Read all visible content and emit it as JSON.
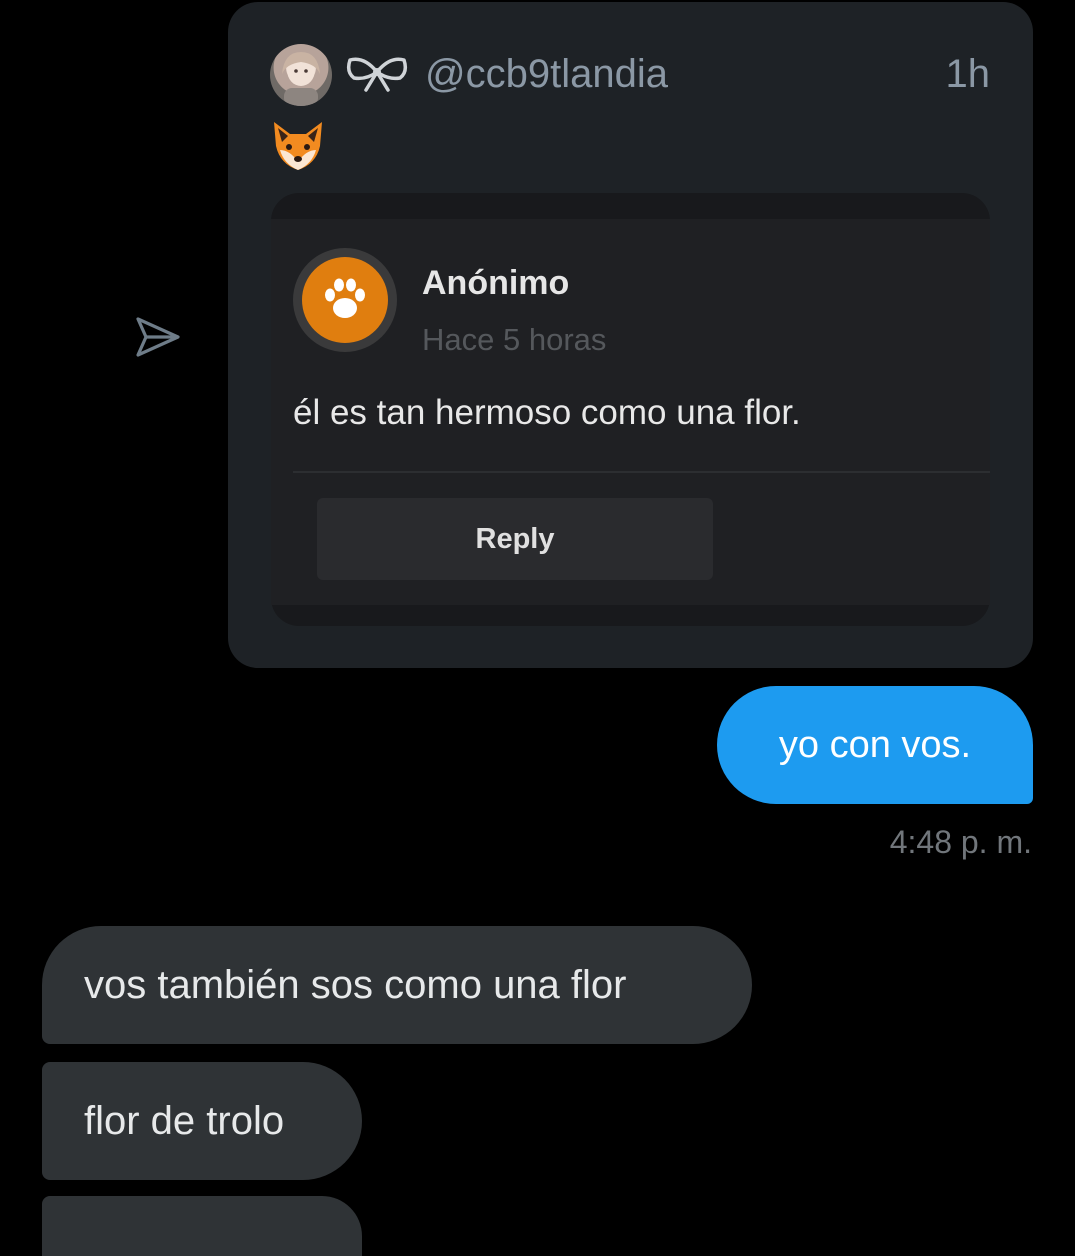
{
  "tweet": {
    "handle": "@ccb9tlandia",
    "time_ago": "1h",
    "icons": {
      "avatar": "user-avatar",
      "decoration": "bow-icon",
      "emoji": "fox-face-icon"
    }
  },
  "embedded_question": {
    "author": "Anónimo",
    "time": "Hace 5 horas",
    "text": "él es tan hermoso como una flor.",
    "reply_label": "Reply",
    "avatar_color": "#e07e0f",
    "icon": "paw-icon"
  },
  "share_icon": "send-icon",
  "messages": {
    "outgoing": [
      {
        "text": "yo con vos.",
        "timestamp": "4:48 p. m."
      }
    ],
    "incoming": [
      {
        "text": "vos también sos como una flor"
      },
      {
        "text": "flor de trolo"
      }
    ]
  },
  "colors": {
    "background": "#000000",
    "outgoing_bubble": "#1d9bf0",
    "incoming_bubble": "#2f3336",
    "card": "#1e2226"
  }
}
